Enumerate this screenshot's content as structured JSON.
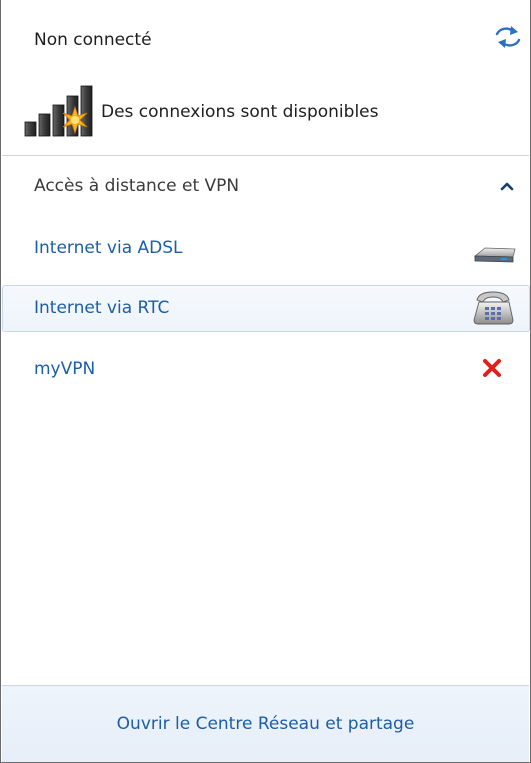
{
  "header": {
    "status_title": "Non connecté",
    "available_text": "Des connexions sont disponibles",
    "icons": [
      "refresh-icon",
      "signal-bars-icon"
    ]
  },
  "section": {
    "title": "Accès à distance et VPN",
    "collapse_icon": "chevron-up-icon"
  },
  "connections": [
    {
      "label": "Internet via ADSL",
      "icon": "modem-icon"
    },
    {
      "label": "Internet via RTC",
      "icon": "dialup-phone-icon"
    },
    {
      "label": "myVPN",
      "icon": "error-x-icon"
    }
  ],
  "footer": {
    "link": "Ouvrir le Centre Réseau et partage"
  },
  "colors": {
    "link": "#1b5ea8",
    "text": "#1e1e1e",
    "selected_bg": "#eef4fb",
    "selected_border": "#c6d8ee",
    "error": "#e0201b"
  }
}
